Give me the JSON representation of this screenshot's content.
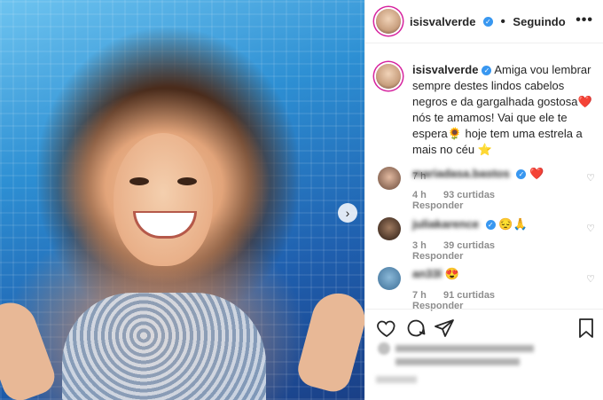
{
  "post": {
    "author": "isisvalverde",
    "follow_status": "Seguindo",
    "caption": "Amiga vou lembrar sempre destes lindos cabelos negros e da gargalhada gostosa❤️ nós te amamos! Vai que ele te espera🌻 hoje tem uma estrela a mais no céu ⭐",
    "time": "7 h"
  },
  "comments": [
    {
      "user": "mariadasa.bastos",
      "text": "❤️",
      "time": "4 h",
      "likes": "93 curtidas",
      "reply": "Responder"
    },
    {
      "user": "juliakarence",
      "text": "😔🙏",
      "time": "3 h",
      "likes": "39 curtidas",
      "reply": "Responder"
    },
    {
      "user": "an33l",
      "text": "😍",
      "time": "7 h",
      "likes": "91 curtidas",
      "reply": "Responder"
    }
  ],
  "icons": {
    "verified": "✓",
    "more": "•••",
    "next": "›",
    "heart_small": "♡"
  }
}
